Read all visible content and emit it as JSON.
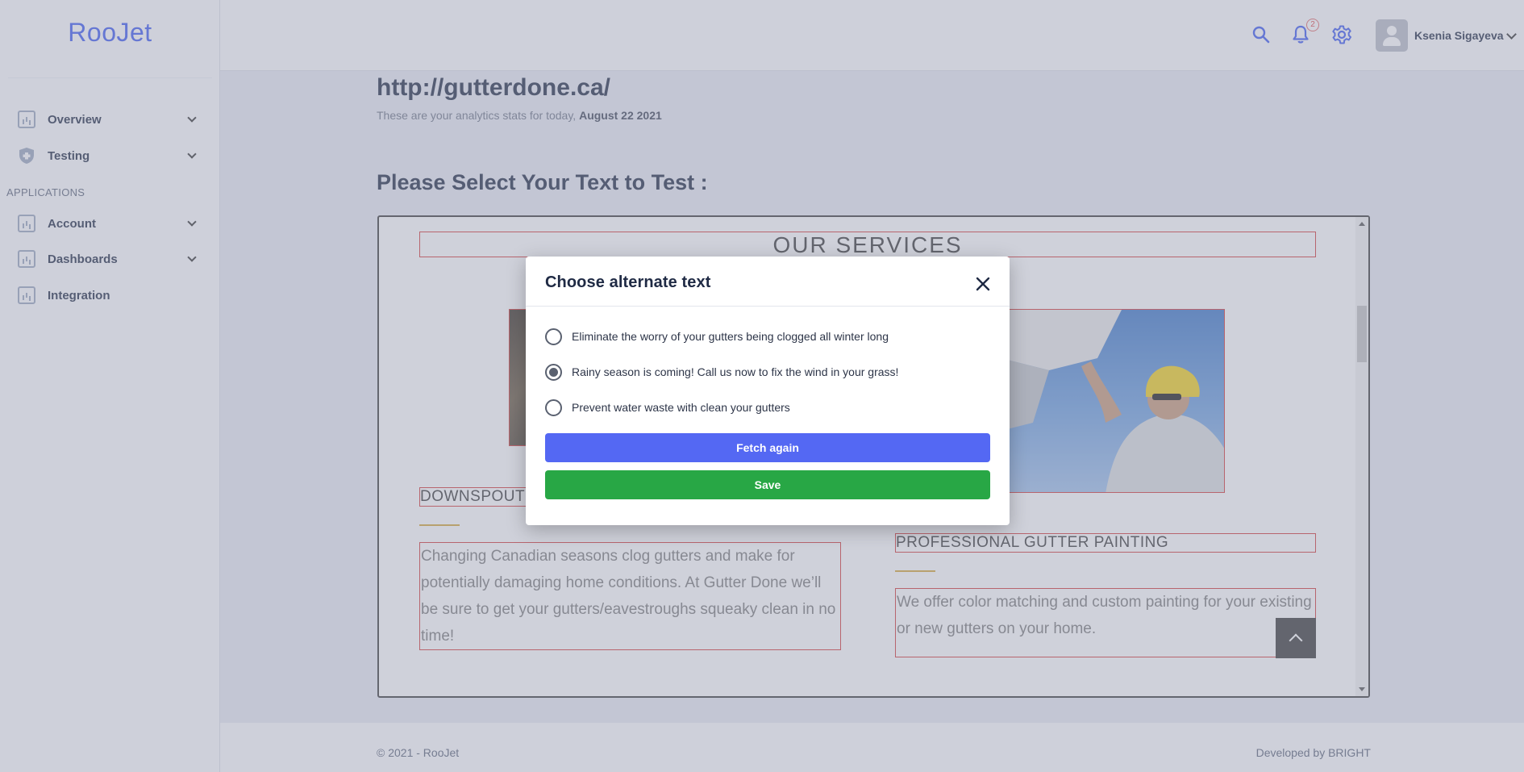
{
  "app": {
    "logo": "RooJet"
  },
  "sidebar": {
    "items": [
      {
        "label": "Overview"
      },
      {
        "label": "Testing"
      },
      {
        "label": "Account"
      },
      {
        "label": "Dashboards"
      },
      {
        "label": "Integration"
      }
    ],
    "section_label": "APPLICATIONS"
  },
  "header": {
    "notification_count": "2",
    "username": "Ksenia Sigayeva",
    "icons": [
      "search-icon",
      "bell-icon",
      "gear-icon",
      "avatar",
      "chevron-down-icon"
    ]
  },
  "main": {
    "site_title": "http://gutterdone.ca/",
    "subtitle_prefix": "These are your analytics stats for today,",
    "subtitle_date": "August 22 2021",
    "select_heading": "Please Select Your Text to Test :"
  },
  "preview": {
    "services_heading": "OUR SERVICES",
    "downspout_heading": "DOWNSPOUT",
    "left_paragraph": "Changing Canadian seasons clog gutters and make for potentially damaging home conditions.  At Gutter Done we’ll be sure to get your gutters/eavestroughs squeaky clean in no time!",
    "painting_heading": "PROFESSIONAL GUTTER PAINTING",
    "right_paragraph": "We offer color matching and custom painting for your existing or new gutters on your home."
  },
  "modal": {
    "title": "Choose alternate text",
    "options": [
      {
        "label": "Eliminate the worry of your gutters being clogged all winter long",
        "selected": false
      },
      {
        "label": "Rainy season is coming! Call us now to fix the wind in your grass!",
        "selected": true
      },
      {
        "label": "Prevent water waste with clean your gutters",
        "selected": false
      }
    ],
    "fetch_label": "Fetch again",
    "save_label": "Save"
  },
  "footer": {
    "copyright": "© 2021 - RooJet",
    "developer": "Developed by BRIGHT"
  },
  "colors": {
    "accent": "#3d5af1",
    "fetch_button": "#5468f3",
    "save_button": "#28a745",
    "highlight_border": "#d43a3a",
    "gold_rule": "#d4a63a"
  }
}
